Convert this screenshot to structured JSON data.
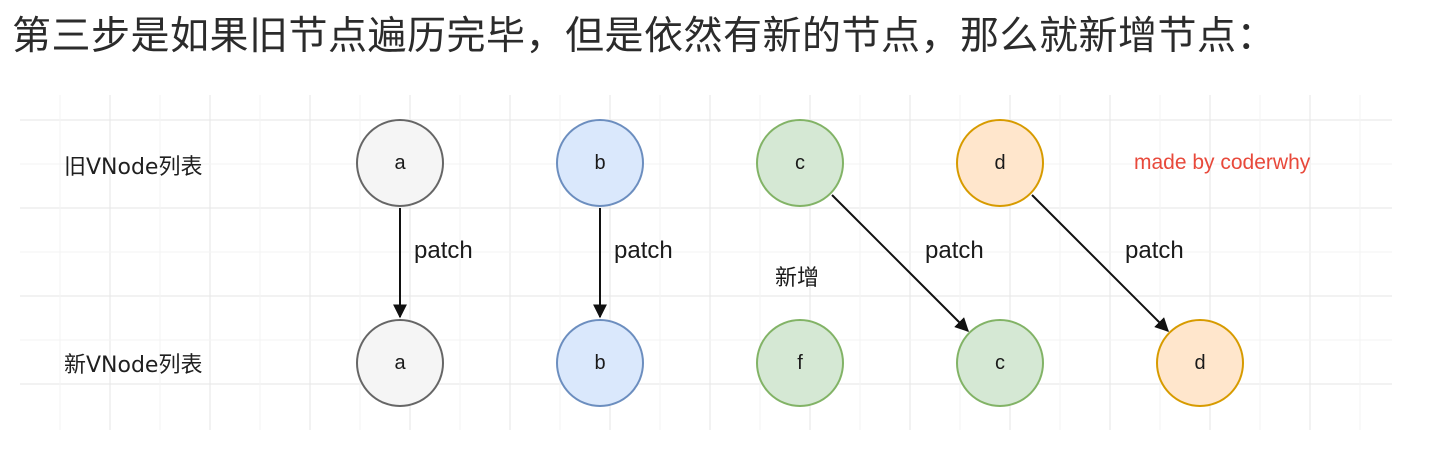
{
  "heading": "第三步是如果旧节点遍历完毕，但是依然有新的节点，那么就新增节点：",
  "diagram": {
    "old_row_label": "旧VNode列表",
    "new_row_label": "新VNode列表",
    "watermark": "made by coderwhy",
    "add_label": "新增",
    "patch_label": "patch",
    "old_nodes": [
      "a",
      "b",
      "c",
      "d"
    ],
    "new_nodes": [
      "a",
      "b",
      "f",
      "c",
      "d"
    ],
    "colors": {
      "gray_fill": "#f5f5f5",
      "gray_stroke": "#666666",
      "blue_fill": "#dae8fc",
      "blue_stroke": "#6c8ebf",
      "green_fill": "#d5e8d4",
      "green_stroke": "#82b366",
      "orange_fill": "#ffe6cc",
      "orange_stroke": "#d79b00",
      "watermark": "#e8493b"
    }
  }
}
